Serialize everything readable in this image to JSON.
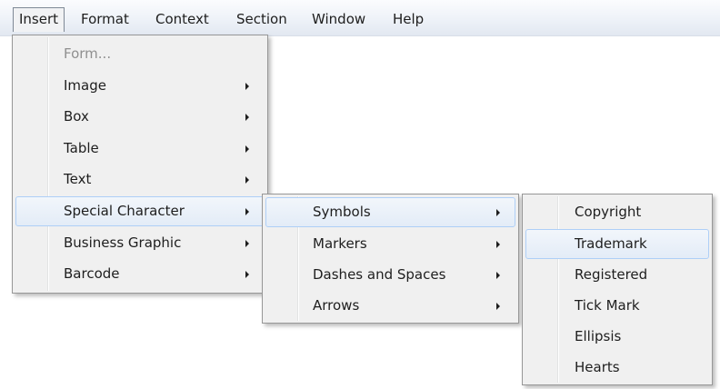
{
  "menubar": {
    "items": [
      "Insert",
      "Format",
      "Context",
      "Section",
      "Window",
      "Help"
    ]
  },
  "insert_menu": {
    "items": [
      {
        "label": "Form...",
        "disabled": true,
        "submenu": false
      },
      {
        "label": "Image",
        "submenu": true
      },
      {
        "label": "Box",
        "submenu": true
      },
      {
        "label": "Table",
        "submenu": true
      },
      {
        "label": "Text",
        "submenu": true
      },
      {
        "label": "Special Character",
        "submenu": true,
        "highlighted": true
      },
      {
        "label": "Business Graphic",
        "submenu": true
      },
      {
        "label": "Barcode",
        "submenu": true
      }
    ]
  },
  "special_character_menu": {
    "items": [
      {
        "label": "Symbols",
        "submenu": true,
        "highlighted": true
      },
      {
        "label": "Markers",
        "submenu": true
      },
      {
        "label": "Dashes and Spaces",
        "submenu": true
      },
      {
        "label": "Arrows",
        "submenu": true
      }
    ]
  },
  "symbols_menu": {
    "items": [
      {
        "label": "Copyright"
      },
      {
        "label": "Trademark",
        "highlighted": true
      },
      {
        "label": "Registered"
      },
      {
        "label": "Tick Mark"
      },
      {
        "label": "Ellipsis"
      },
      {
        "label": "Hearts"
      }
    ]
  },
  "colors": {
    "highlight_fill": "#e3ecf7",
    "highlight_border": "#aecff7",
    "menu_background": "#f0f0f0",
    "disabled_text": "#8f8f8f"
  }
}
